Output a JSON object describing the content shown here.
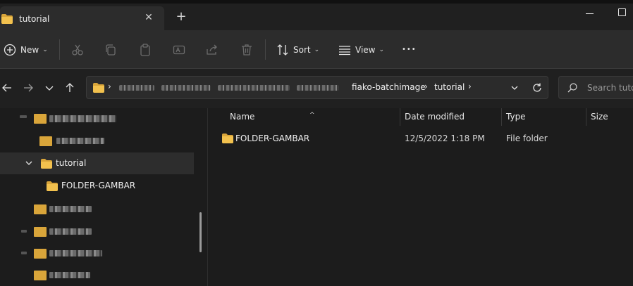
{
  "window": {
    "tab_title": "tutorial",
    "tab_close_glyph": "✕",
    "new_tab_glyph": "+"
  },
  "toolbar": {
    "new_label": "New",
    "sort_label": "Sort",
    "view_label": "View",
    "more_glyph": "•••",
    "icons": [
      "cut-icon",
      "copy-icon",
      "paste-icon",
      "rename-icon",
      "share-icon",
      "delete-icon"
    ]
  },
  "address": {
    "crumbs": [
      "fiako-batchimage",
      "tutorial"
    ],
    "separator": "›"
  },
  "search": {
    "placeholder": "Search tutor"
  },
  "nav_pane": {
    "selected_label": "tutorial",
    "child_label": "FOLDER-GAMBAR"
  },
  "columns": {
    "name": "Name",
    "date_modified": "Date modified",
    "type": "Type",
    "size": "Size",
    "sort_glyph": "^"
  },
  "files": [
    {
      "name": "FOLDER-GAMBAR",
      "date_modified": "12/5/2022 1:18 PM",
      "type": "File folder",
      "size": ""
    }
  ],
  "colors": {
    "folder": "#f2c14e",
    "folder_dark": "#d9a53a",
    "background": "#1c1c1c",
    "toolbar": "#2c2c2c"
  }
}
